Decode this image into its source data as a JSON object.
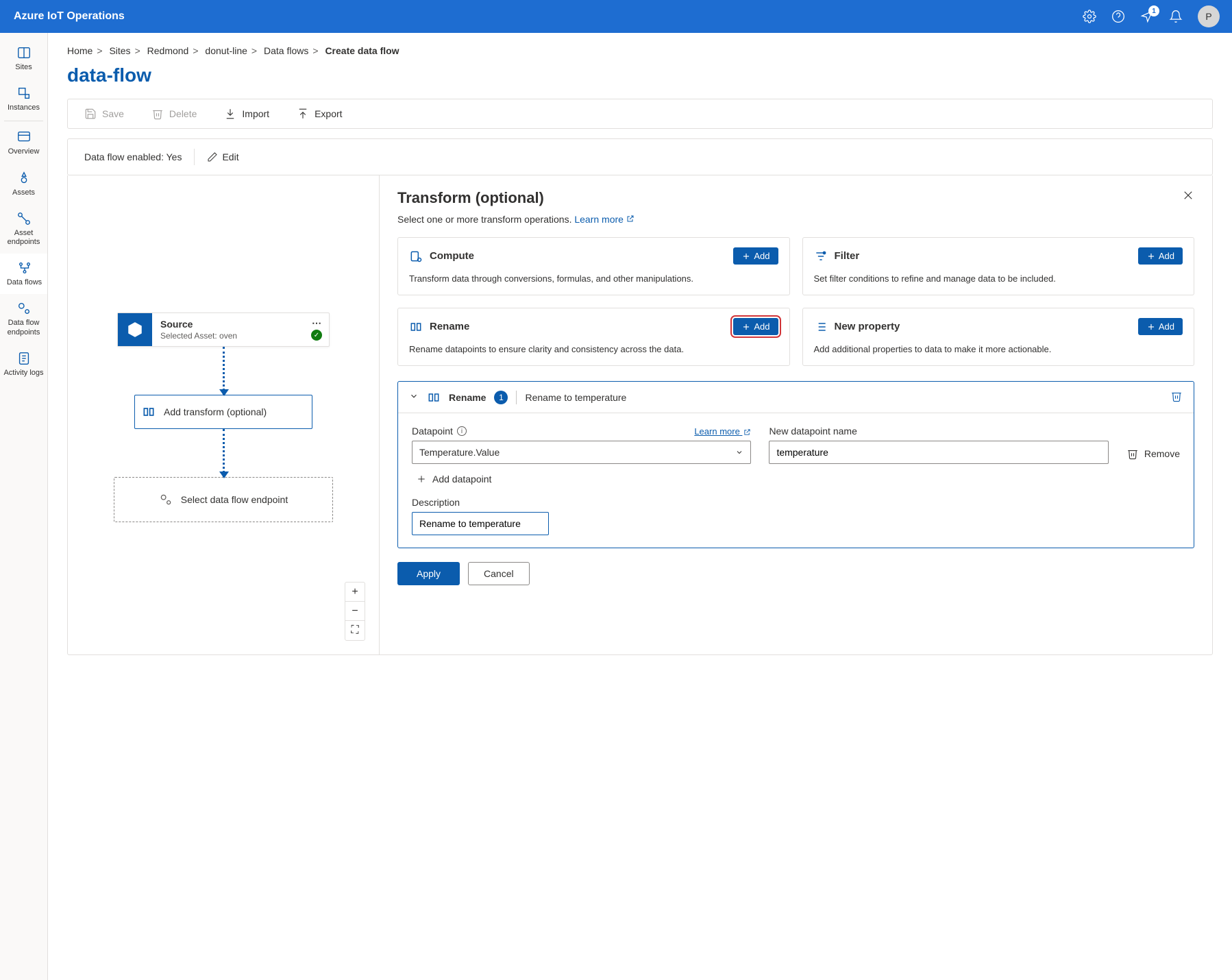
{
  "header": {
    "brand": "Azure IoT Operations",
    "notificationCount": "1",
    "avatarInitial": "P"
  },
  "nav": {
    "items": [
      {
        "label": "Sites"
      },
      {
        "label": "Instances"
      },
      {
        "label": "Overview"
      },
      {
        "label": "Assets"
      },
      {
        "label": "Asset endpoints"
      },
      {
        "label": "Data flows"
      },
      {
        "label": "Data flow endpoints"
      },
      {
        "label": "Activity logs"
      }
    ]
  },
  "breadcrumb": {
    "items": [
      "Home",
      "Sites",
      "Redmond",
      "donut-line",
      "Data flows"
    ],
    "current": "Create data flow"
  },
  "page": {
    "title": "data-flow",
    "toolbar": {
      "save": "Save",
      "delete": "Delete",
      "import": "Import",
      "export": "Export"
    },
    "status": {
      "label": "Data flow enabled: Yes",
      "edit": "Edit"
    }
  },
  "canvas": {
    "source": {
      "title": "Source",
      "subtitle": "Selected Asset: oven"
    },
    "transform": "Add transform (optional)",
    "endpoint": "Select data flow endpoint",
    "zoom": {
      "in": "+",
      "out": "−",
      "fit": "⛶"
    }
  },
  "panel": {
    "title": "Transform (optional)",
    "subtitle": "Select one or more transform operations. ",
    "learnMore": "Learn more",
    "cards": {
      "compute": {
        "title": "Compute",
        "desc": "Transform data through conversions, formulas, and other manipulations.",
        "add": "Add"
      },
      "filter": {
        "title": "Filter",
        "desc": "Set filter conditions to refine and manage data to be included.",
        "add": "Add"
      },
      "rename": {
        "title": "Rename",
        "desc": "Rename datapoints to ensure clarity and consistency across the data.",
        "add": "Add"
      },
      "newprop": {
        "title": "New property",
        "desc": "Add additional properties to data to make it more actionable.",
        "add": "Add"
      }
    },
    "renameSection": {
      "title": "Rename",
      "count": "1",
      "summary": "Rename to temperature",
      "datapointLabel": "Datapoint",
      "learnMore": "Learn more",
      "datapointValue": "Temperature.Value",
      "newNameLabel": "New datapoint name",
      "newNameValue": "temperature",
      "remove": "Remove",
      "addDatapoint": "Add datapoint",
      "descLabel": "Description",
      "descValue": "Rename to temperature"
    },
    "actions": {
      "apply": "Apply",
      "cancel": "Cancel"
    }
  }
}
